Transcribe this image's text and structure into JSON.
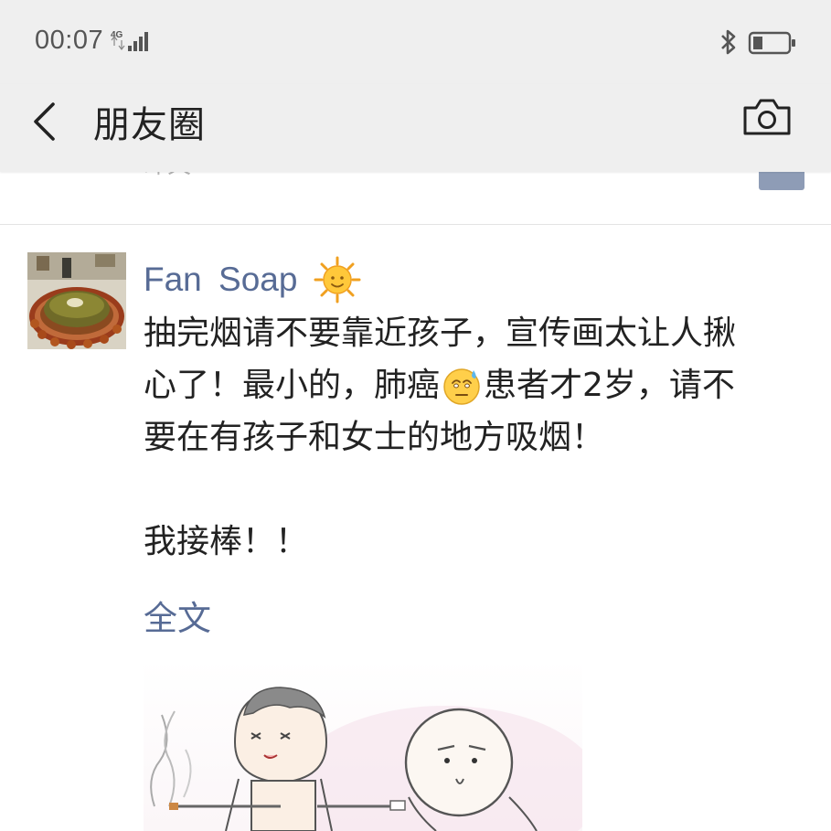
{
  "status_bar": {
    "time": "00:07",
    "network": "4G",
    "icons": [
      "signal-icon",
      "bluetooth-icon",
      "battery-icon"
    ]
  },
  "nav": {
    "title": "朋友圈",
    "icons": [
      "back-chevron-icon",
      "camera-icon"
    ]
  },
  "previous_post": {
    "time_fragment": "昨天"
  },
  "post": {
    "author": "Fan  Soap",
    "author_emoji": "sun-face-icon",
    "lines": [
      {
        "before": "抽完烟请不要靠近孩子，宣传画太让人揪",
        "after": ""
      },
      {
        "before": "心了！最小的，肺癌",
        "after": "患者才2岁，请不"
      },
      {
        "before": "要在有孩子和女士的地方吸烟！",
        "after": ""
      }
    ],
    "inline_emoji": "sweat-face-icon",
    "second_paragraph": "我接棒！！",
    "full_text_link": "全文"
  },
  "colors": {
    "bar_bg": "#efefef",
    "link_blue": "#576b95",
    "text": "#222222",
    "divider": "#e3e3e3"
  }
}
